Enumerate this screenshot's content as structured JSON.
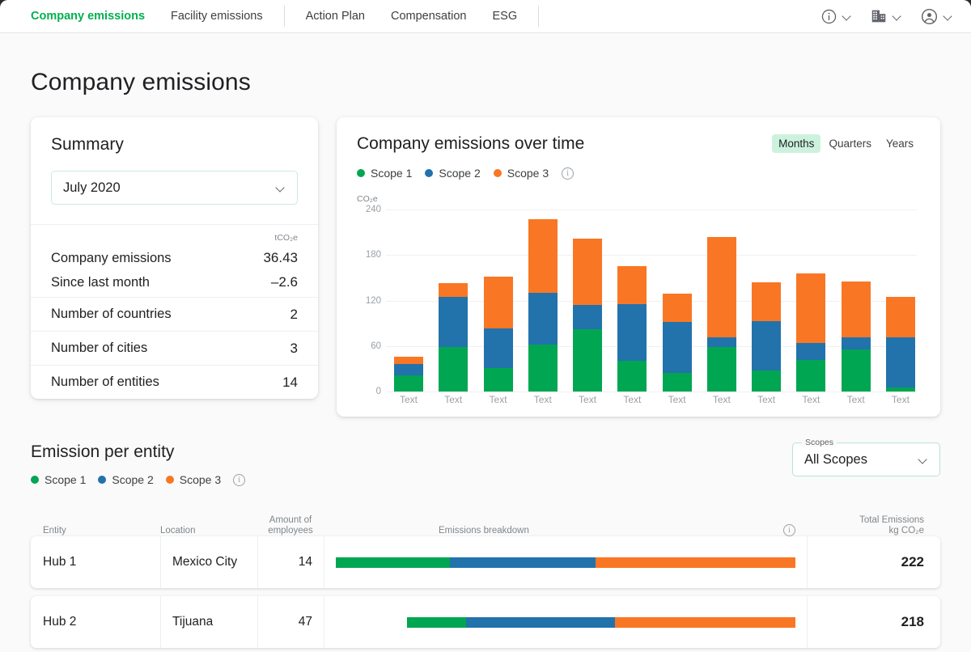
{
  "colors": {
    "scope1": "#00a651",
    "scope2": "#2272ac",
    "scope3": "#f97724",
    "accent": "#00b050",
    "segment_active_bg": "#ccf2dd"
  },
  "nav": {
    "tabs": [
      {
        "label": "Company emissions",
        "active": true
      },
      {
        "label": "Facility emissions",
        "active": false
      },
      {
        "label": "Action Plan",
        "active": false
      },
      {
        "label": "Compensation",
        "active": false
      },
      {
        "label": "ESG",
        "active": false
      }
    ],
    "right_icons": [
      {
        "name": "info-icon",
        "glyph": "i"
      },
      {
        "name": "building-icon",
        "glyph": "building"
      },
      {
        "name": "account-icon",
        "glyph": "account"
      }
    ]
  },
  "page": {
    "title": "Company emissions"
  },
  "summary": {
    "title": "Summary",
    "period_value": "July 2020",
    "unit": "tCO₂e",
    "metrics": [
      {
        "label": "Company emissions",
        "value": "36.43"
      },
      {
        "label": "Since last month",
        "value": "–2.6"
      }
    ],
    "counts": [
      {
        "label": "Number of countries",
        "value": "2"
      },
      {
        "label": "Number of cities",
        "value": "3"
      },
      {
        "label": "Number of entities",
        "value": "14"
      }
    ]
  },
  "chart_card": {
    "title": "Company emissions over time",
    "segments": [
      {
        "label": "Months",
        "active": true
      },
      {
        "label": "Quarters",
        "active": false
      },
      {
        "label": "Years",
        "active": false
      }
    ],
    "legend": [
      {
        "label": "Scope 1",
        "color": "#00a651"
      },
      {
        "label": "Scope 2",
        "color": "#2272ac"
      },
      {
        "label": "Scope 3",
        "color": "#f97724"
      }
    ],
    "legend_info_icon": "info-icon"
  },
  "chart_data": {
    "type": "bar",
    "stacked": true,
    "title": "Company emissions over time",
    "xlabel": "",
    "ylabel": "CO₂e",
    "unit": "CO₂e",
    "ylim": [
      0,
      240
    ],
    "yticks": [
      0,
      60,
      120,
      180,
      240
    ],
    "grid": true,
    "legend_position": "top-left",
    "categories": [
      "Text",
      "Text",
      "Text",
      "Text",
      "Text",
      "Text",
      "Text",
      "Text",
      "Text",
      "Text",
      "Text",
      "Text"
    ],
    "series": [
      {
        "name": "Scope 1",
        "color": "#00a651",
        "values": [
          21,
          59,
          31,
          62,
          82,
          41,
          25,
          59,
          28,
          42,
          55,
          5
        ]
      },
      {
        "name": "Scope 2",
        "color": "#2272ac",
        "values": [
          15,
          66,
          52,
          68,
          32,
          74,
          67,
          12,
          65,
          22,
          17,
          66
        ]
      },
      {
        "name": "Scope 3",
        "color": "#f97724",
        "values": [
          10,
          18,
          69,
          97,
          88,
          50,
          37,
          133,
          51,
          92,
          73,
          54
        ]
      }
    ],
    "totals": [
      46,
      143,
      152,
      227,
      202,
      165,
      129,
      204,
      144,
      156,
      145,
      125
    ]
  },
  "entity_section": {
    "title": "Emission per entity",
    "legend": [
      {
        "label": "Scope 1",
        "color": "#00a651"
      },
      {
        "label": "Scope 2",
        "color": "#2272ac"
      },
      {
        "label": "Scope 3",
        "color": "#f97724"
      }
    ],
    "legend_info_icon": "info-icon",
    "scopes_select": {
      "label": "Scopes",
      "value": "All Scopes"
    },
    "table": {
      "headers": {
        "entity": "Entity",
        "location": "Location",
        "employees": "Amount of\nemployees",
        "breakdown": "Emissions breakdown",
        "breakdown_info_icon": "info-icon",
        "total": "Total Emissions\nkg CO₂e"
      },
      "header_employees_line1": "Amount of",
      "header_employees_line2": "employees",
      "header_total_line1": "Total Emissions",
      "header_total_line2": "kg CO₂e",
      "rows": [
        {
          "entity": "Hub 1",
          "location": "Mexico City",
          "employees": "14",
          "total": "222",
          "breakdown": {
            "scope1_pct": 24.8,
            "scope2_pct": 31.8,
            "scope3_pct": 43.4,
            "bar_width_pct": 100
          }
        },
        {
          "entity": "Hub 2",
          "location": "Tijuana",
          "employees": "47",
          "total": "218",
          "breakdown": {
            "scope1_pct": 15.2,
            "scope2_pct": 38.4,
            "scope3_pct": 46.4,
            "bar_width_pct": 84.5
          }
        }
      ]
    }
  }
}
